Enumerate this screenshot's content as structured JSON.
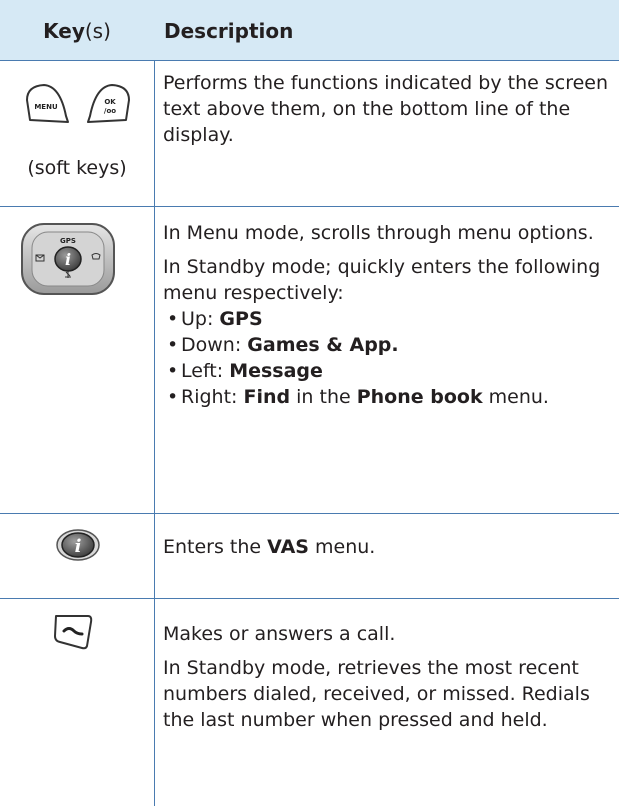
{
  "header": {
    "key_bold": "Key",
    "key_rest": "(s)",
    "description": "Description"
  },
  "rows": [
    {
      "key_note": "(soft keys)",
      "icons": [
        "menu-soft-key-icon",
        "ok-soft-key-icon"
      ],
      "icon_labels": {
        "left": "MENU",
        "right_top": "OK",
        "right_bottom": "/oo"
      },
      "description": "Performs the functions indicated by the screen text above them, on the bottom line of the display."
    },
    {
      "icons": [
        "navigation-key-icon"
      ],
      "icon_labels": {
        "top": "GPS"
      },
      "para1": "In Menu mode, scrolls through menu options.",
      "para2": "In Standby mode; quickly enters the following menu respectively:",
      "bullets": [
        {
          "lead": "Up: ",
          "bold": "GPS",
          "tail": ""
        },
        {
          "lead": "Down: ",
          "bold": "Games & App.",
          "tail": ""
        },
        {
          "lead": "Left: ",
          "bold": "Message",
          "tail": ""
        },
        {
          "lead": "Right: ",
          "bold": "Find",
          "mid": " in the ",
          "bold2": "Phone book",
          "tail": " menu."
        }
      ]
    },
    {
      "icons": [
        "vas-key-icon"
      ],
      "lead": "Enters the ",
      "bold": "VAS",
      "tail": " menu."
    },
    {
      "icons": [
        "send-key-icon"
      ],
      "para1": "Makes or answers a call.",
      "para2": "In Standby mode, retrieves the most recent numbers dialed, received, or missed. Redials the last number when pressed and held."
    }
  ]
}
